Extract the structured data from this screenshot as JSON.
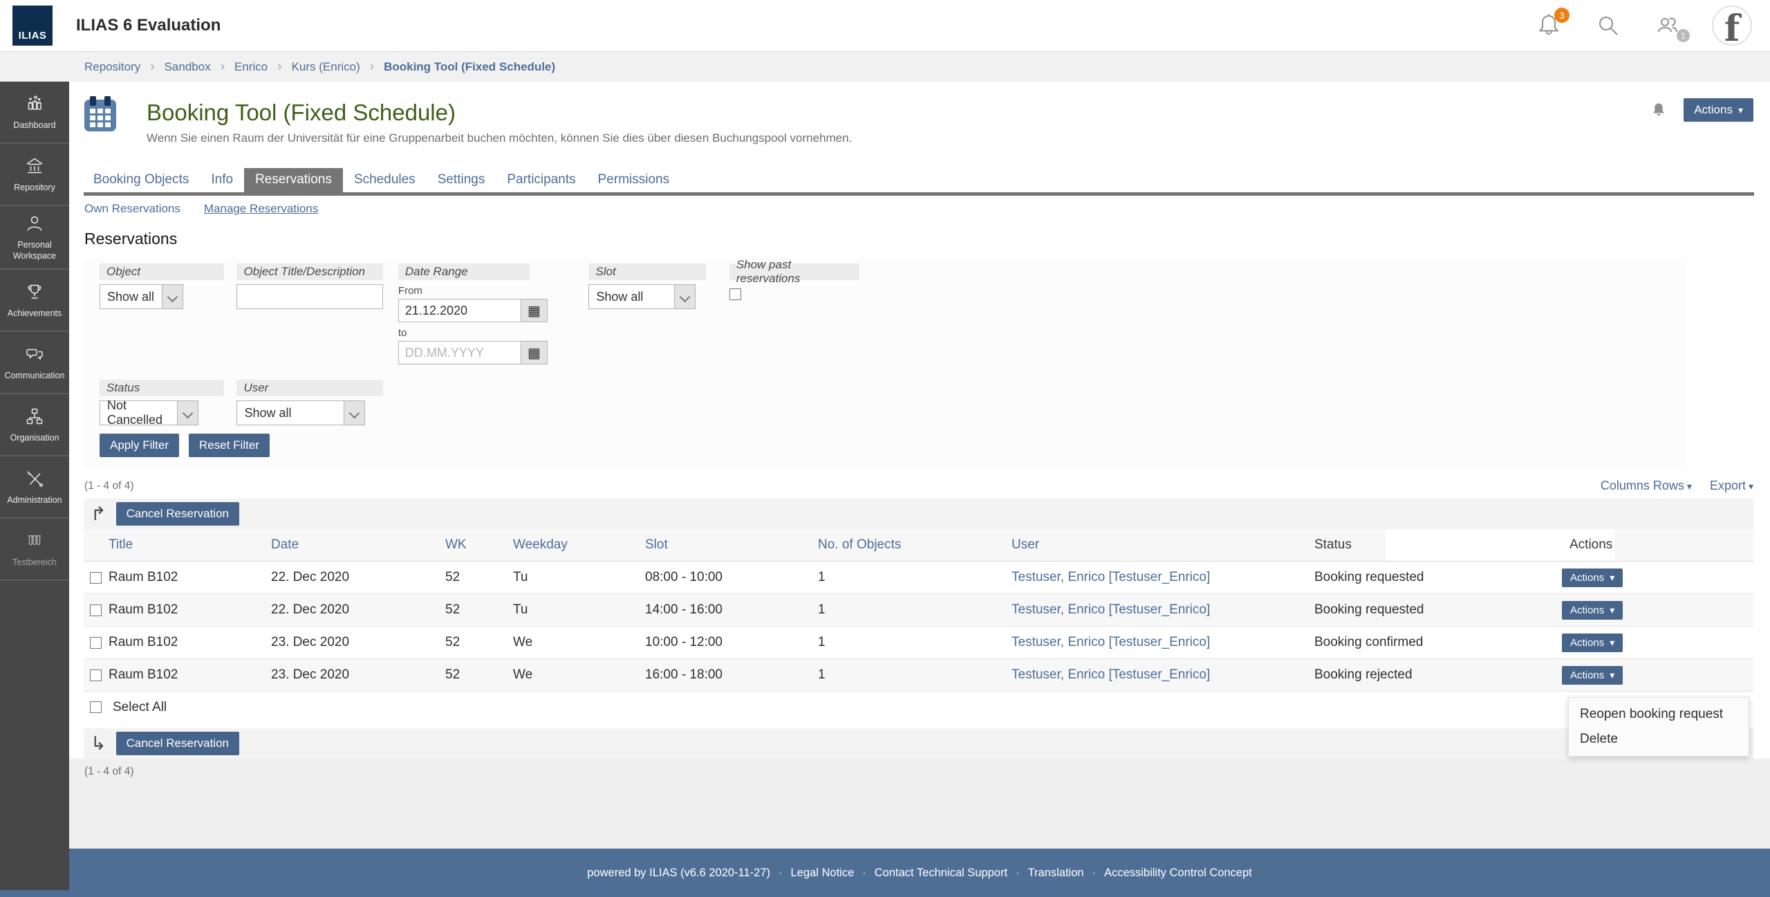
{
  "colors": {
    "accent_blue": "#4d6d99",
    "button_blue": "#47648b",
    "footer_blue": "#4e6e96",
    "title_green": "#3e5f17",
    "sidebar_gray": "#474747",
    "active_tab_gray": "#757575",
    "badge_orange": "#ec8013",
    "logo_navy": "#0d2e4e"
  },
  "icons": {
    "caret_down": "▾",
    "breadcrumb_separator": "›",
    "arrow_apply_top": "↱",
    "arrow_apply_bottom": "↳",
    "calendar_glyph": "▦"
  },
  "header": {
    "logo_text": "ILIAS",
    "app_title": "ILIAS 6 Evaluation",
    "notification_badge": "3",
    "contacts_badge": "1",
    "avatar_letter": "f"
  },
  "breadcrumb": {
    "items": [
      {
        "label": "Repository"
      },
      {
        "label": "Sandbox"
      },
      {
        "label": "Enrico"
      },
      {
        "label": "Kurs (Enrico)"
      },
      {
        "label": "Booking Tool (Fixed Schedule)"
      }
    ]
  },
  "sidebar": {
    "items": [
      {
        "label": "Dashboard"
      },
      {
        "label": "Repository"
      },
      {
        "label": "Personal Workspace"
      },
      {
        "label": "Achievements"
      },
      {
        "label": "Communication"
      },
      {
        "label": "Organisation"
      },
      {
        "label": "Administration"
      },
      {
        "label": "Testbereich"
      }
    ]
  },
  "page": {
    "title": "Booking Tool (Fixed Schedule)",
    "description": "Wenn Sie einen Raum der Universität für eine Gruppenarbeit buchen möchten, können Sie dies über diesen Buchungspool vornehmen.",
    "actions_button": "Actions"
  },
  "tabs": [
    {
      "label": "Booking Objects"
    },
    {
      "label": "Info"
    },
    {
      "label": "Reservations"
    },
    {
      "label": "Schedules"
    },
    {
      "label": "Settings"
    },
    {
      "label": "Participants"
    },
    {
      "label": "Permissions"
    }
  ],
  "subtabs": [
    {
      "label": "Own Reservations"
    },
    {
      "label": "Manage Reservations"
    }
  ],
  "section": {
    "title": "Reservations"
  },
  "filter": {
    "object_label": "Object",
    "object_value": "Show all",
    "title_label": "Object Title/Description",
    "date_label": "Date Range",
    "from_label": "From",
    "to_label": "to",
    "from_value": "21.12.2020",
    "to_placeholder": "DD.MM.YYYY",
    "slot_label": "Slot",
    "slot_value": "Show all",
    "past_label": "Show past reservations",
    "status_label": "Status",
    "status_value": "Not Cancelled",
    "user_label": "User",
    "user_value": "Show all",
    "apply_button": "Apply Filter",
    "reset_button": "Reset Filter"
  },
  "table": {
    "range_top": "(1 - 4 of 4)",
    "range_bottom": "(1 - 4 of 4)",
    "columns_rows_label": "Columns Rows",
    "export_label": "Export",
    "cancel_button": "Cancel Reservation",
    "select_all_label": "Select All",
    "headers": {
      "title": "Title",
      "date": "Date",
      "wk": "WK",
      "weekday": "Weekday",
      "slot": "Slot",
      "objects": "No. of Objects",
      "user": "User",
      "status": "Status",
      "actions": "Actions"
    },
    "rows": [
      {
        "title": "Raum B102",
        "date": "22. Dec 2020",
        "wk": "52",
        "weekday": "Tu",
        "slot": "08:00 - 10:00",
        "objects": "1",
        "user": "Testuser, Enrico [Testuser_Enrico]",
        "status": "Booking requested",
        "actions_button": "Actions"
      },
      {
        "title": "Raum B102",
        "date": "22. Dec 2020",
        "wk": "52",
        "weekday": "Tu",
        "slot": "14:00 - 16:00",
        "objects": "1",
        "user": "Testuser, Enrico [Testuser_Enrico]",
        "status": "Booking requested",
        "actions_button": "Actions"
      },
      {
        "title": "Raum B102",
        "date": "23. Dec 2020",
        "wk": "52",
        "weekday": "We",
        "slot": "10:00 - 12:00",
        "objects": "1",
        "user": "Testuser, Enrico [Testuser_Enrico]",
        "status": "Booking confirmed",
        "actions_button": "Actions"
      },
      {
        "title": "Raum B102",
        "date": "23. Dec 2020",
        "wk": "52",
        "weekday": "We",
        "slot": "16:00 - 18:00",
        "objects": "1",
        "user": "Testuser, Enrico [Testuser_Enrico]",
        "status": "Booking rejected",
        "actions_button": "Actions"
      }
    ]
  },
  "dropdown": {
    "items": [
      {
        "label": "Reopen booking request"
      },
      {
        "label": "Delete"
      }
    ]
  },
  "footer": {
    "powered": "powered by ILIAS (v6.6 2020-11-27)",
    "separator": "·",
    "links": [
      {
        "label": "Legal Notice"
      },
      {
        "label": "Contact Technical Support"
      },
      {
        "label": "Translation"
      },
      {
        "label": "Accessibility Control Concept"
      }
    ]
  }
}
